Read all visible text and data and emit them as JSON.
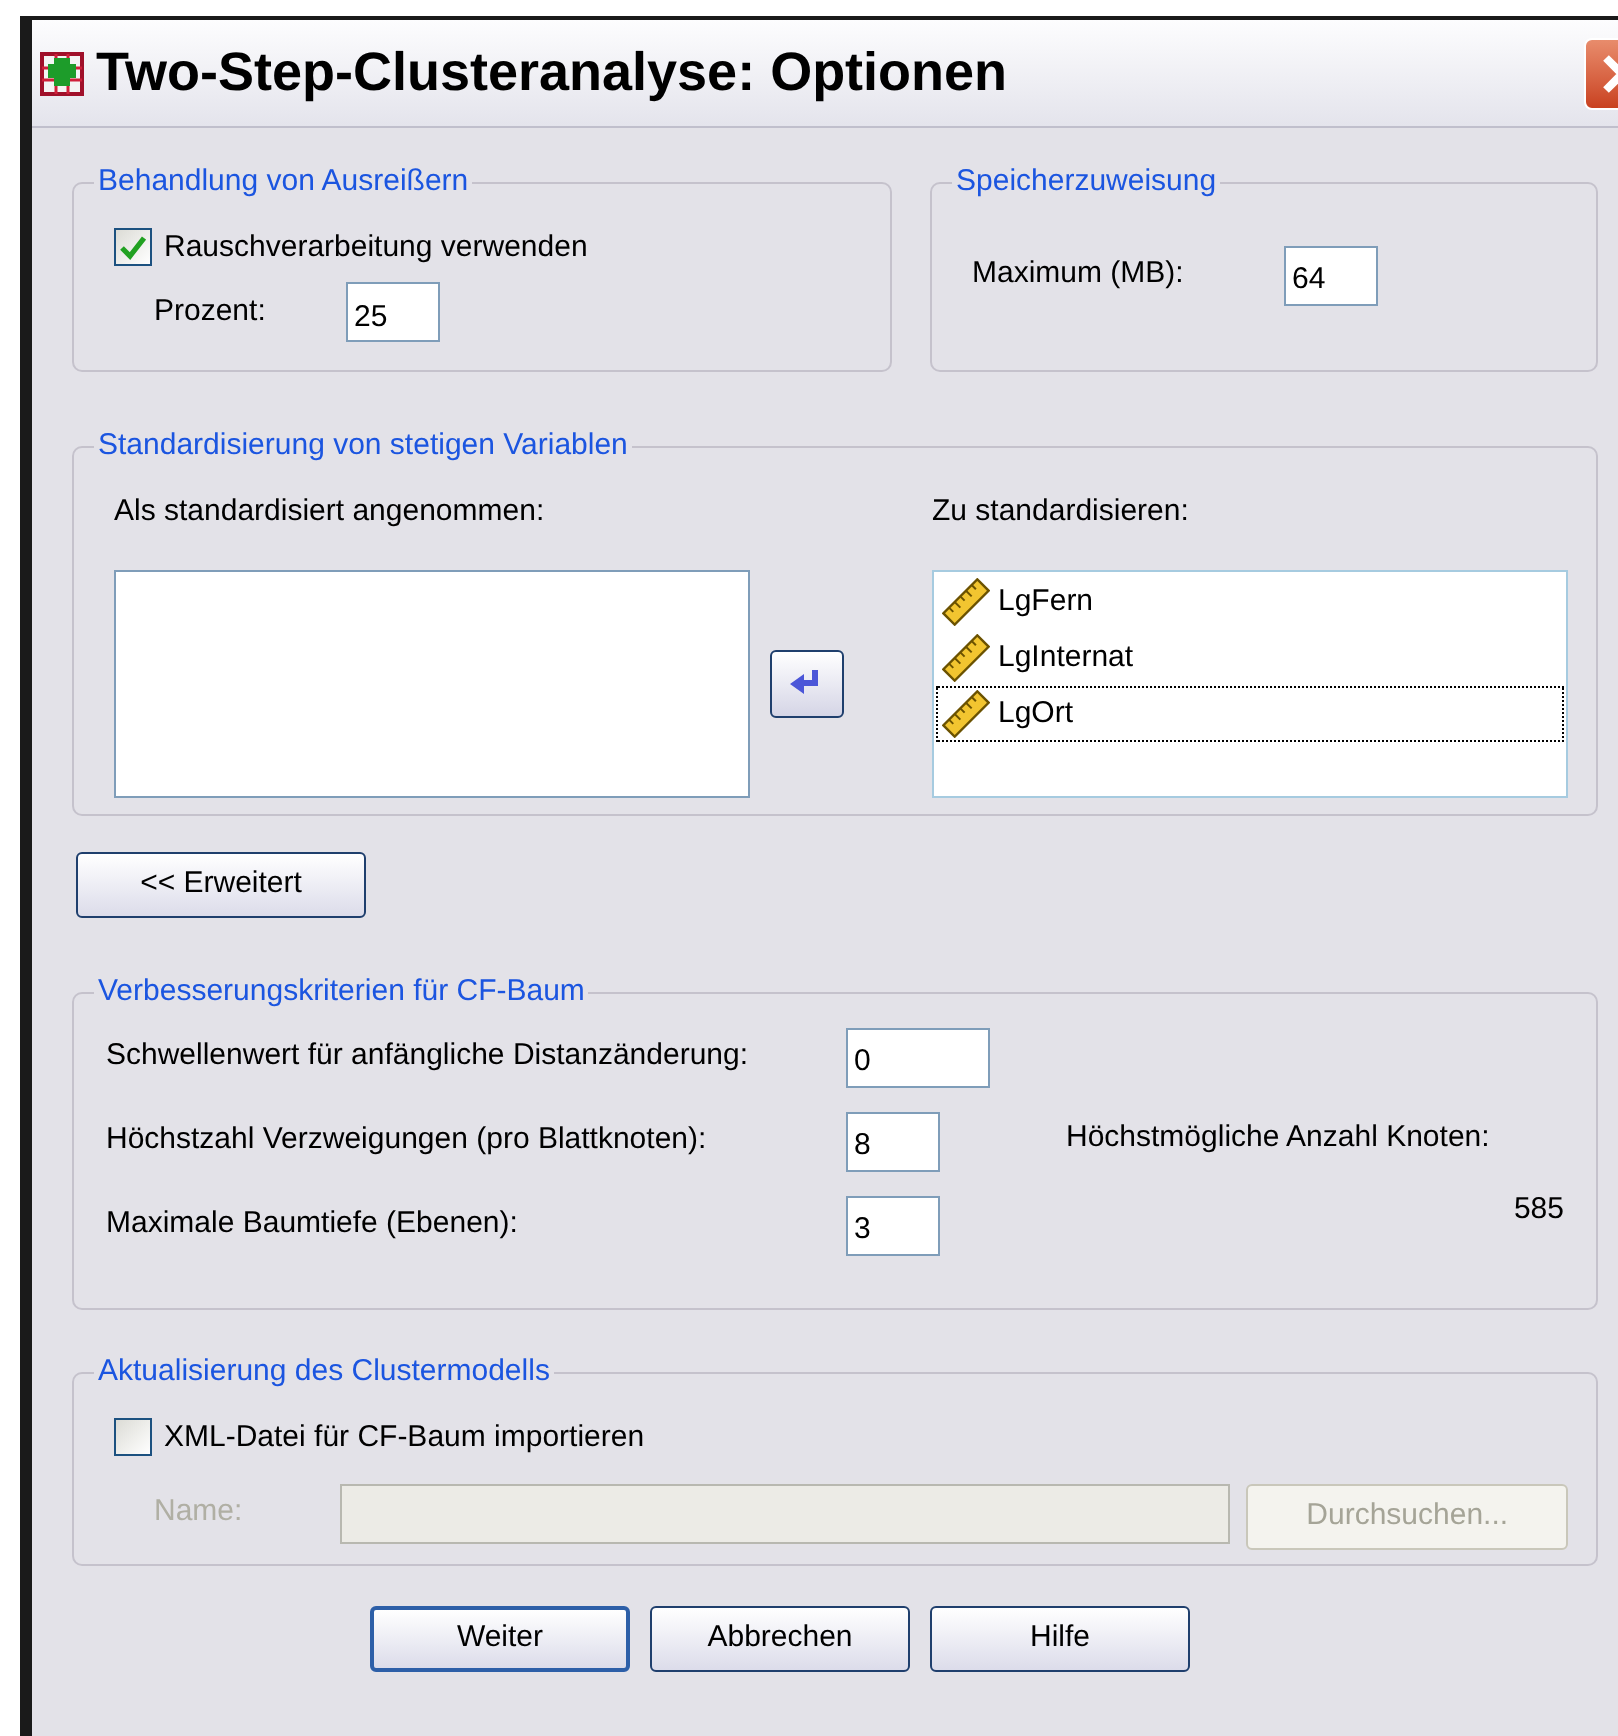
{
  "window": {
    "title": "Two-Step-Clusteranalyse: Optionen"
  },
  "outliers": {
    "title": "Behandlung von Ausreißern",
    "noise": {
      "label": "Rauschverarbeitung verwenden",
      "checked": true
    },
    "percent": {
      "label": "Prozent:",
      "value": "25"
    }
  },
  "memory": {
    "title": "Speicherzuweisung",
    "maximum": {
      "label": "Maximum (MB):",
      "value": "64"
    }
  },
  "standardize": {
    "title": "Standardisierung von stetigen Variablen",
    "assumed_label": "Als standardisiert angenommen:",
    "target_label": "Zu standardisieren:",
    "target_items": [
      {
        "name": "LgFern",
        "focused": false
      },
      {
        "name": "LgInternat",
        "focused": false
      },
      {
        "name": "LgOrt",
        "focused": true
      }
    ]
  },
  "advanced_button": {
    "label": "<< Erweitert"
  },
  "cf_tree": {
    "title": "Verbesserungskriterien für CF-Baum",
    "fields": [
      {
        "label": "Schwellenwert für anfängliche Distanzänderung:",
        "value": "0",
        "wide": true
      },
      {
        "label": "Höchstzahl Verzweigungen (pro Blattknoten):",
        "value": "8",
        "wide": false
      },
      {
        "label": "Maximale Baumtiefe (Ebenen):",
        "value": "3",
        "wide": false
      }
    ],
    "max_nodes_label": "Höchstmögliche Anzahl Knoten:",
    "max_nodes_value": "585"
  },
  "update": {
    "title": "Aktualisierung des Clustermodells",
    "import": {
      "label": "XML-Datei für CF-Baum importieren",
      "checked": false
    },
    "name": {
      "label": "Name:",
      "disabled": true
    },
    "browse_button": {
      "label": "Durchsuchen...",
      "disabled": true
    }
  },
  "buttons": [
    {
      "label": "Weiter",
      "default": true
    },
    {
      "label": "Abbrechen",
      "default": false
    },
    {
      "label": "Hilfe",
      "default": false
    }
  ]
}
